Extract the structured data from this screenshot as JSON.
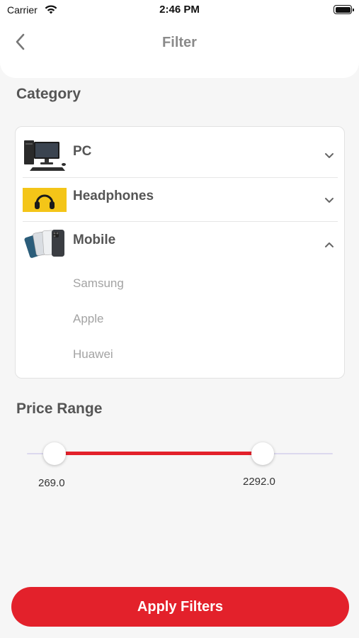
{
  "status_bar": {
    "carrier": "Carrier",
    "time": "2:46 PM",
    "icons": [
      "wifi-icon",
      "battery-icon"
    ]
  },
  "header": {
    "title": "Filter",
    "back_icon": "chevron-left-icon"
  },
  "category": {
    "title": "Category",
    "items": [
      {
        "label": "PC",
        "image": "desktop-pc-image",
        "expanded": false,
        "chevron": "chevron-down-icon"
      },
      {
        "label": "Headphones",
        "image": "headphones-image",
        "expanded": false,
        "chevron": "chevron-down-icon"
      },
      {
        "label": "Mobile",
        "image": "mobile-phones-image",
        "expanded": true,
        "chevron": "chevron-up-icon",
        "subitems": [
          "Samsung",
          "Apple",
          "Huawei"
        ]
      }
    ]
  },
  "price_range": {
    "title": "Price Range",
    "min_value": "269.0",
    "max_value": "2292.0",
    "selected_fraction": [
      0.09,
      0.77
    ]
  },
  "apply_button": {
    "label": "Apply Filters"
  },
  "colors": {
    "accent": "#e3212b",
    "background": "#f6f6f6",
    "card": "#ffffff",
    "track": "#dcd9ee"
  }
}
